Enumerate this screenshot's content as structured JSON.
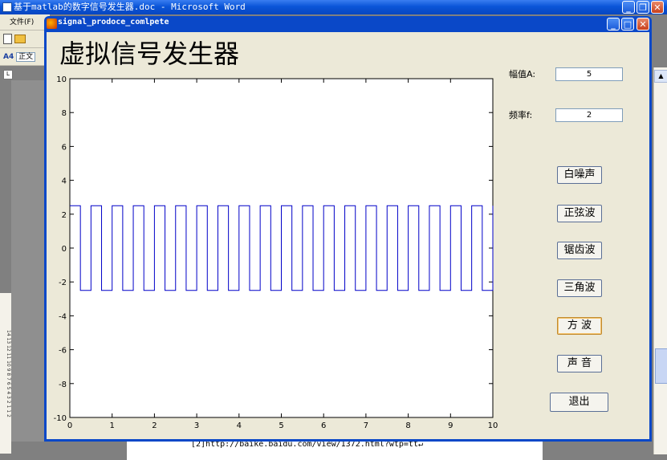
{
  "word": {
    "window_title": "基于matlab的数字信号发生器.doc - Microsoft Word",
    "menu_file": "文件(F)",
    "style_box": "正文",
    "style_icon": "A4",
    "doc_line": "[2]http://baike.baidu.com/view/1372.html?wtp=tt↵",
    "ruler": "14 13 12 11 10 9 8 7 6 5 4 3 2 1 1 2"
  },
  "figure": {
    "window_title": "signal_prodoce_comlpete",
    "heading": "虚拟信号发生器",
    "amplitude_label": "幅值A:",
    "amplitude_value": "5",
    "frequency_label": "频率f:",
    "frequency_value": "2"
  },
  "buttons": {
    "white_noise": "白噪声",
    "sine": "正弦波",
    "sawtooth": "锯齿波",
    "triangle": "三角波",
    "square": "方 波",
    "sound": "声 音",
    "exit": "退出"
  },
  "colors": {
    "signal": "#0000c8",
    "xp_blue": "#0a48c8",
    "panel": "#ece9d8"
  },
  "chart_data": {
    "type": "line",
    "title": "",
    "xlabel": "",
    "ylabel": "",
    "xlim": [
      0,
      10
    ],
    "ylim": [
      -10,
      10
    ],
    "xticks": [
      "0",
      "1",
      "2",
      "3",
      "4",
      "5",
      "6",
      "7",
      "8",
      "9",
      "10"
    ],
    "yticks": [
      "10",
      "8",
      "6",
      "4",
      "2",
      "0",
      "-2",
      "-4",
      "-6",
      "-8",
      "-10"
    ],
    "grid": false,
    "series": [
      {
        "waveform": "square",
        "amplitude": 2.5,
        "frequency": 2,
        "x_range": [
          0,
          10
        ]
      }
    ]
  }
}
